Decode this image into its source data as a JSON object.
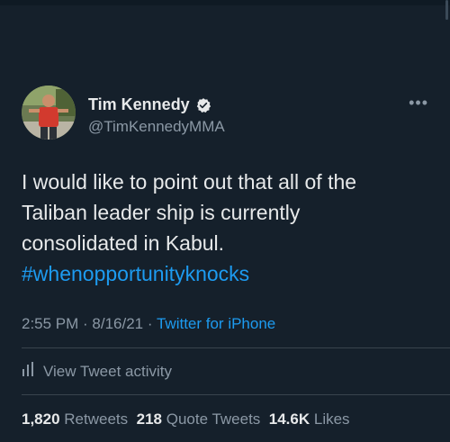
{
  "tweet": {
    "author": {
      "name": "Tim Kennedy",
      "handle": "@TimKennedyMMA"
    },
    "more_label": "•••",
    "text_lines": [
      "I would like to point out that all of the",
      "Taliban leader ship is currently",
      "consolidated in Kabul."
    ],
    "hashtag": "#whenopportunityknocks",
    "time": "2:55 PM",
    "sep1": " · ",
    "date": "8/16/21",
    "sep2": " · ",
    "source": "Twitter for iPhone",
    "activity_label": "View Tweet activity",
    "stats": {
      "retweets_count": "1,820",
      "retweets_label": "Retweets",
      "quotes_count": "218",
      "quotes_label": "Quote Tweets",
      "likes_count": "14.6K",
      "likes_label": "Likes"
    }
  },
  "colors": {
    "background": "#15202b",
    "accent": "#1d9bf0",
    "secondary_text": "#8b98a5",
    "primary_text": "#e7e9ea"
  },
  "icons": [
    "verified-badge-icon",
    "more-options-icon",
    "activity-bars-icon"
  ]
}
